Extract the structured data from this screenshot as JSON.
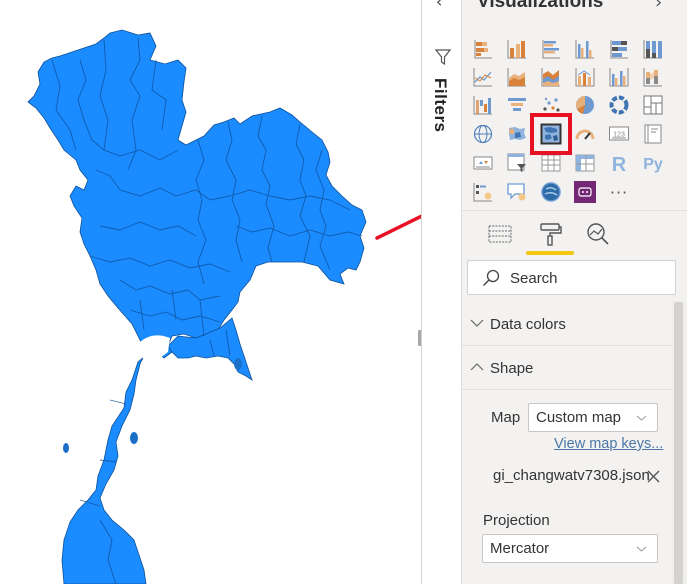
{
  "canvas": {
    "visual": "shape-map",
    "map_region": "Thailand provinces",
    "fill_color": "#1a8cff",
    "border_color": "#0d4f99",
    "annotation_color": "#e81123"
  },
  "filters_pane": {
    "label": "Filters",
    "collapse_icon": "chevron-left",
    "icon": "funnel"
  },
  "visualizations_pane": {
    "title": "Visualizations",
    "expand_icon": "chevron-right",
    "icons": [
      [
        "stacked-bar-chart",
        "stacked-column-chart",
        "clustered-bar-chart",
        "clustered-column-chart",
        "100-stacked-bar-chart",
        "100-stacked-column-chart"
      ],
      [
        "line-chart",
        "area-chart",
        "stacked-area-chart",
        "line-and-stacked-column-chart",
        "line-and-clustered-column-chart",
        "ribbon-chart"
      ],
      [
        "waterfall-chart",
        "funnel-chart",
        "scatter-chart",
        "pie-chart",
        "donut-chart",
        "treemap"
      ],
      [
        "map",
        "filled-map",
        "shape-map",
        "gauge",
        "card",
        "multi-row-card"
      ],
      [
        "kpi",
        "slicer",
        "table",
        "matrix",
        "r-script-visual",
        "python-visual"
      ],
      [
        "key-influencers",
        "qa-visual",
        "arcgis-map",
        "power-apps",
        "more-visuals"
      ]
    ],
    "selected_icon": "shape-map",
    "more_label": "···",
    "r_label": "R",
    "py_label": "Py",
    "card_label": "123",
    "tabs": [
      {
        "name": "fields",
        "active": false
      },
      {
        "name": "format",
        "active": true
      },
      {
        "name": "analytics",
        "active": false
      }
    ],
    "accent_color": "#f2c811",
    "search": {
      "placeholder": "Search",
      "value": ""
    },
    "sections": [
      {
        "label": "Data colors",
        "expanded": false
      },
      {
        "label": "Shape",
        "expanded": true
      }
    ],
    "shape": {
      "map_label": "Map",
      "map_value": "Custom map",
      "view_map_keys": "View map keys...",
      "file_name": "gi_changwatv7308.json",
      "projection_label": "Projection",
      "projection_value": "Mercator"
    }
  }
}
